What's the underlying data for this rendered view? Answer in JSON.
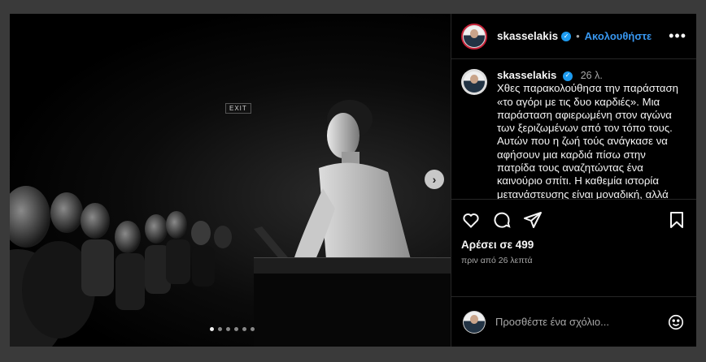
{
  "post": {
    "username": "skasselakis",
    "follow_label": "Ακολουθήστε",
    "separator": "•",
    "more_label": "•••",
    "caption_time": "26 λ.",
    "caption_text": "Χθες παρακολούθησα την παράσταση «το αγόρι με τις δυο καρδιές». Μια παράσταση αφιερωμένη στον αγώνα των ξεριζωμένων από τον τόπο τους. Αυτών που η ζωή τούς ανάγκασε να αφήσουν μια καρδιά πίσω στην πατρίδα τους αναζητώντας ένα καινούριο σπίτι. Η καθεμία ιστορία μετανάστευσης είναι μοναδική, αλλά και κοινή για όσους ακολούθησαν αυτόν τον δρόμο. Γιατί η γλώσσα της μετανάστευσης και της",
    "likes_label": "Αρέσει σε 499",
    "time_ago": "πριν από 26 λεπτά",
    "comment_placeholder": "Προσθέστε ένα σχόλιο...",
    "verified_glyph": "✓"
  },
  "media": {
    "exit_sign": "EXIT",
    "next_glyph": "›",
    "slide_count": 6,
    "active_slide": 1
  },
  "icons": {
    "like": "heart-icon",
    "comment": "comment-icon",
    "share": "share-icon",
    "save": "bookmark-icon",
    "emoji": "emoji-icon"
  },
  "colors": {
    "follow": "#3897f0",
    "verified": "#1d9bf0",
    "background": "#000000"
  }
}
